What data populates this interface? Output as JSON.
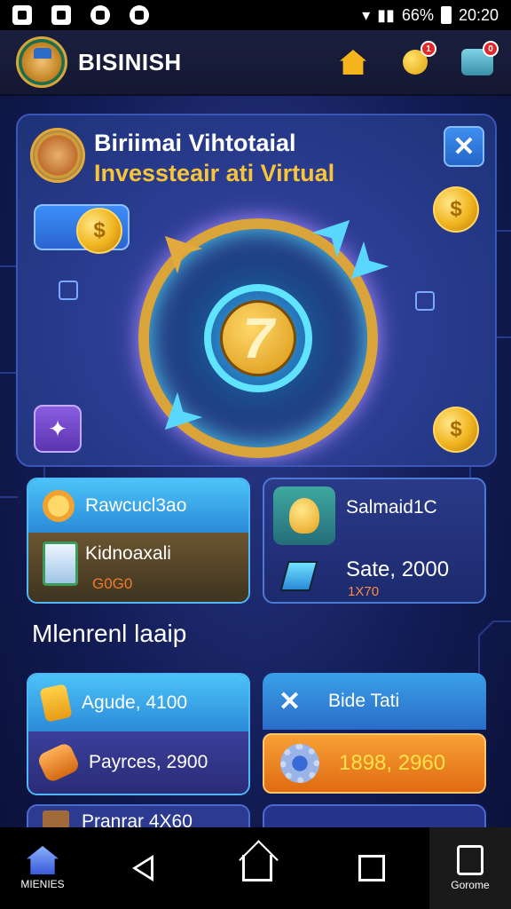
{
  "status_bar": {
    "battery": "66%",
    "time": "20:20"
  },
  "header": {
    "title": "BISINISH",
    "coin_badge": "1",
    "cart_badge": "0"
  },
  "hero": {
    "title_line1": "Biriimai Vihtotaial",
    "title_line2": "Invessteair ati Virtual",
    "close": "✕",
    "dial_number": "7",
    "coin_symbol": "$"
  },
  "cards": {
    "search_card": {
      "label": "Rawcucl3ao",
      "sub_label": "Kidnoaxali",
      "sub_value": "G0G0"
    },
    "idea_card": {
      "label": "Salmaid1C",
      "value": "Sate, 2000",
      "sub_value": "1X70"
    }
  },
  "section": {
    "title": "Mlenrenl laaip"
  },
  "list": {
    "left_top": "Agude, 4100",
    "left_bottom": "Payrces, 2900",
    "right_top": "Bide Tati",
    "right_bottom": "1898, 2960",
    "partial": "Pranrar 4X60"
  },
  "nav": {
    "menu_label": "MIENIES",
    "games_label": "Gorome"
  },
  "colors": {
    "accent_gold": "#f8c43a",
    "accent_blue": "#4cc3f8",
    "accent_orange": "#f7a035"
  },
  "icons": [
    "home-icon",
    "coin-icon",
    "cart-icon",
    "close-icon",
    "magnifier-icon",
    "document-icon",
    "bulb-icon",
    "book-icon",
    "phone-icon",
    "barrel-icon",
    "x-icon",
    "gear-icon",
    "compass-icon",
    "back-icon",
    "square-icon"
  ]
}
